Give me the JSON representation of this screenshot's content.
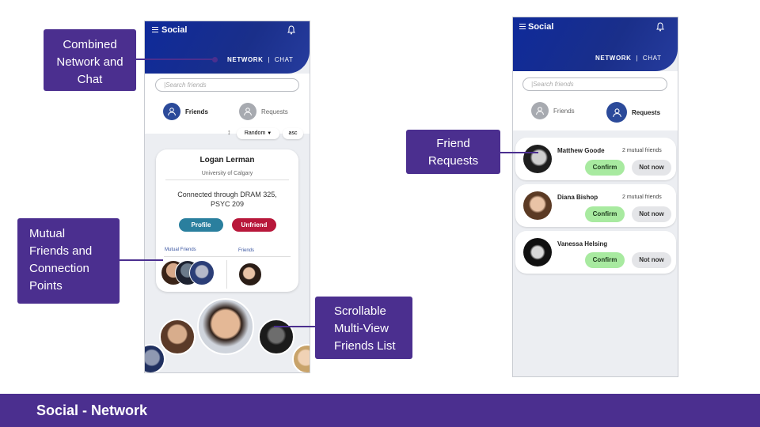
{
  "slide": {
    "footer_title": "Social - Network"
  },
  "callouts": {
    "combined": "Combined Network and Chat",
    "mutual": "Mutual Friends and Connection Points",
    "scrollable": "Scrollable Multi-View Friends List",
    "requests": "Friend Requests"
  },
  "phone_left": {
    "app_title": "Social",
    "nav_network": "NETWORK",
    "nav_sep": "|",
    "nav_chat": "CHAT",
    "search_placeholder": "|Search friends",
    "tab_friends": "Friends",
    "tab_requests": "Requests",
    "sort_order": "Random",
    "sort_dir": "asc",
    "card": {
      "name": "Logan Lerman",
      "school": "University of Calgary",
      "connection": "Connected through DRAM 325, PSYC 209",
      "profile_btn": "Profile",
      "unfriend_btn": "Unfriend",
      "mutual_label": "Mutual Friends",
      "friends_label": "Friends"
    }
  },
  "phone_right": {
    "app_title": "Social",
    "nav_network": "NETWORK",
    "nav_sep": "|",
    "nav_chat": "CHAT",
    "search_placeholder": "|Search friends",
    "tab_friends": "Friends",
    "tab_requests": "Requests",
    "requests": [
      {
        "name": "Matthew Goode",
        "mutual": "2 mutual friends",
        "confirm": "Confirm",
        "not_now": "Not now"
      },
      {
        "name": "Diana Bishop",
        "mutual": "2 mutual friends",
        "confirm": "Confirm",
        "not_now": "Not now"
      },
      {
        "name": "Vanessa Helsing",
        "mutual": "",
        "confirm": "Confirm",
        "not_now": "Not now"
      }
    ]
  },
  "colors": {
    "header": "#10288f",
    "callout": "#4b2f8f",
    "profile": "#2a7f9e",
    "unfriend": "#b8173a",
    "confirm": "#a8eaa0"
  }
}
